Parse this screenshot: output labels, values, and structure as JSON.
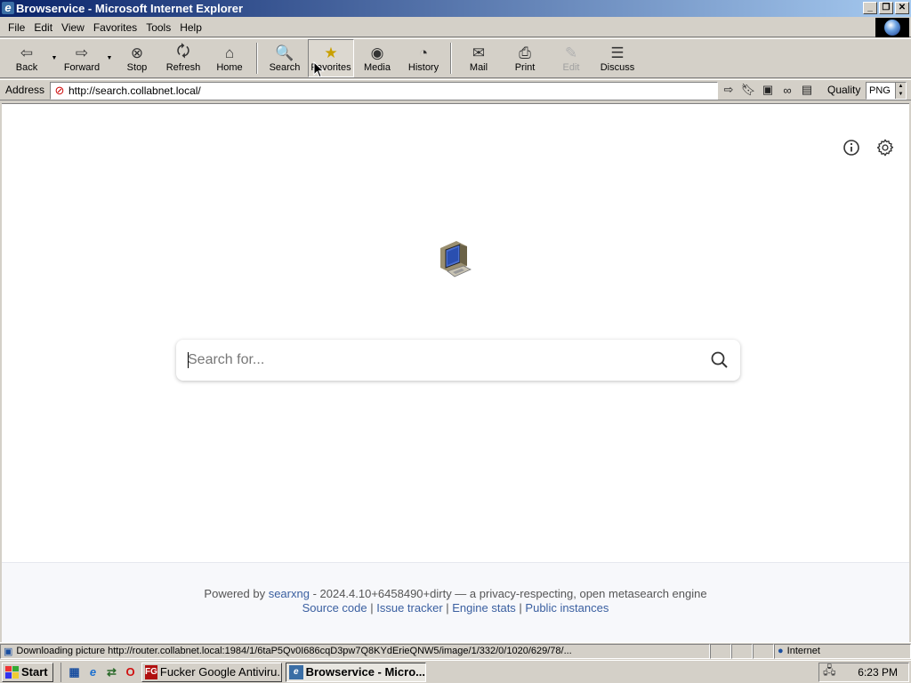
{
  "window": {
    "title": "Browservice - Microsoft Internet Explorer",
    "controls": [
      "_",
      "❐",
      "✕"
    ]
  },
  "menubar": {
    "items": [
      "File",
      "Edit",
      "View",
      "Favorites",
      "Tools",
      "Help"
    ]
  },
  "toolbar": {
    "back": "Back",
    "forward": "Forward",
    "stop": "Stop",
    "refresh": "Refresh",
    "home": "Home",
    "search": "Search",
    "favorites": "Favorites",
    "media": "Media",
    "history": "History",
    "mail": "Mail",
    "print": "Print",
    "edit": "Edit",
    "discuss": "Discuss"
  },
  "address": {
    "label": "Address",
    "url": "http://search.collabnet.local/",
    "quality_label": "Quality",
    "quality_value": "PNG"
  },
  "page": {
    "search_placeholder": "Search for...",
    "footer": {
      "powered_by": "Powered by",
      "engine_link": "searxng",
      "version_text": " - 2024.4.10+6458490+dirty — a privacy-respecting, open metasearch engine",
      "links": [
        "Source code",
        "Issue tracker",
        "Engine stats",
        "Public instances"
      ],
      "separator": " | "
    }
  },
  "statusbar": {
    "message": "Downloading picture http://router.collabnet.local:1984/1/6taP5Qv0I686cqD3pw7Q8KYdErieQNW5/image/1/332/0/1020/629/78/...",
    "zone": "Internet"
  },
  "taskbar": {
    "start": "Start",
    "tasks": [
      {
        "label": "Fucker Google Antiviru...",
        "icon": "FG"
      },
      {
        "label": "Browservice - Micro...",
        "icon": "e"
      }
    ],
    "clock": "6:23 PM"
  },
  "colors": {
    "titlebar_start": "#0a246a",
    "titlebar_end": "#a6caf0",
    "link": "#3a5fa0",
    "chrome": "#d4d0c8"
  }
}
